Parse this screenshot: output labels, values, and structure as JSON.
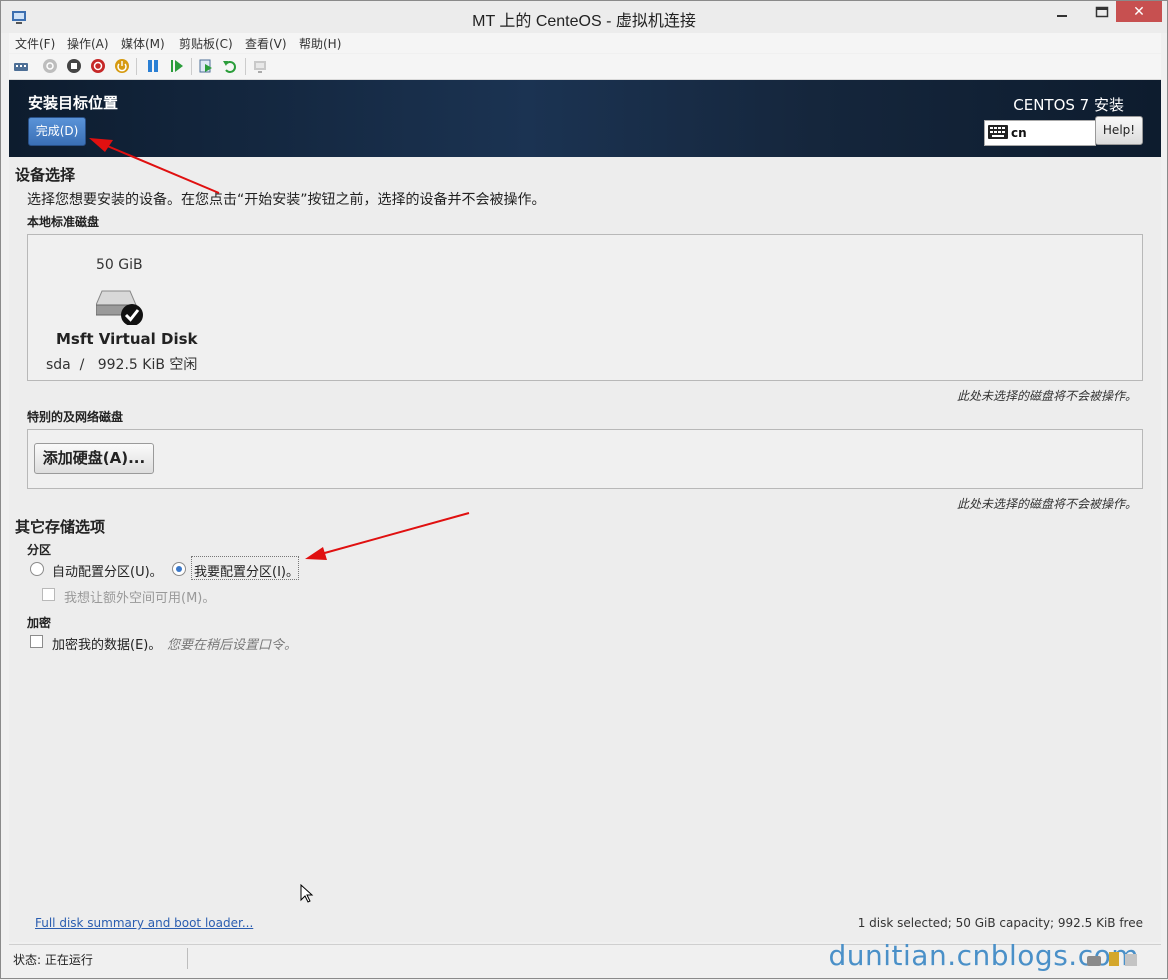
{
  "window": {
    "title": "MT 上的 CenteOS - 虚拟机连接"
  },
  "menu": [
    "文件(F)",
    "操作(A)",
    "媒体(M)",
    "剪贴板(C)",
    "查看(V)",
    "帮助(H)"
  ],
  "toolbar_icons": [
    "ctrl-alt-del-icon",
    "start-icon",
    "turn-off-icon",
    "shutdown-icon",
    "power-icon",
    "pause-icon",
    "resume-icon",
    "checkpoint-icon",
    "revert-icon",
    "enhanced-session-icon"
  ],
  "header": {
    "title": "安装目标位置",
    "done_button": "完成(D)",
    "product": "CENTOS 7 安装",
    "keyboard_layout": "cn",
    "help_button": "Help!"
  },
  "device_selection": {
    "title": "设备选择",
    "description": "选择您想要安装的设备。在您点击“开始安装”按钮之前，选择的设备并不会被操作。",
    "local_disks_label": "本地标准磁盘",
    "disk": {
      "size": "50 GiB",
      "name": "Msft Virtual Disk",
      "detail": "sda  /   992.5 KiB 空闲"
    },
    "local_hint": "此处未选择的磁盘将不会被操作。",
    "special_disks_label": "特别的及网络磁盘",
    "add_disk_button": "添加硬盘(A)...",
    "special_hint": "此处未选择的磁盘将不会被操作。"
  },
  "other_storage": {
    "title": "其它存储选项",
    "partition_label": "分区",
    "auto_partition": "自动配置分区(U)。",
    "manual_partition": "我要配置分区(I)。",
    "extra_space": "我想让额外空间可用(M)。",
    "encryption_label": "加密",
    "encrypt_data": "加密我的数据(E)。",
    "encrypt_hint": "您要在稍后设置口令。"
  },
  "footer": {
    "summary_link": "Full disk summary and boot loader...",
    "summary_text": "1 disk selected; 50 GiB capacity; 992.5 KiB free"
  },
  "status_bar": {
    "status": "状态: 正在运行"
  },
  "watermark": "dunitian.cnblogs.com",
  "colors": {
    "header_bg": "#15263c",
    "accent_blue": "#3a6fb5",
    "arrow_red": "#e01010"
  }
}
